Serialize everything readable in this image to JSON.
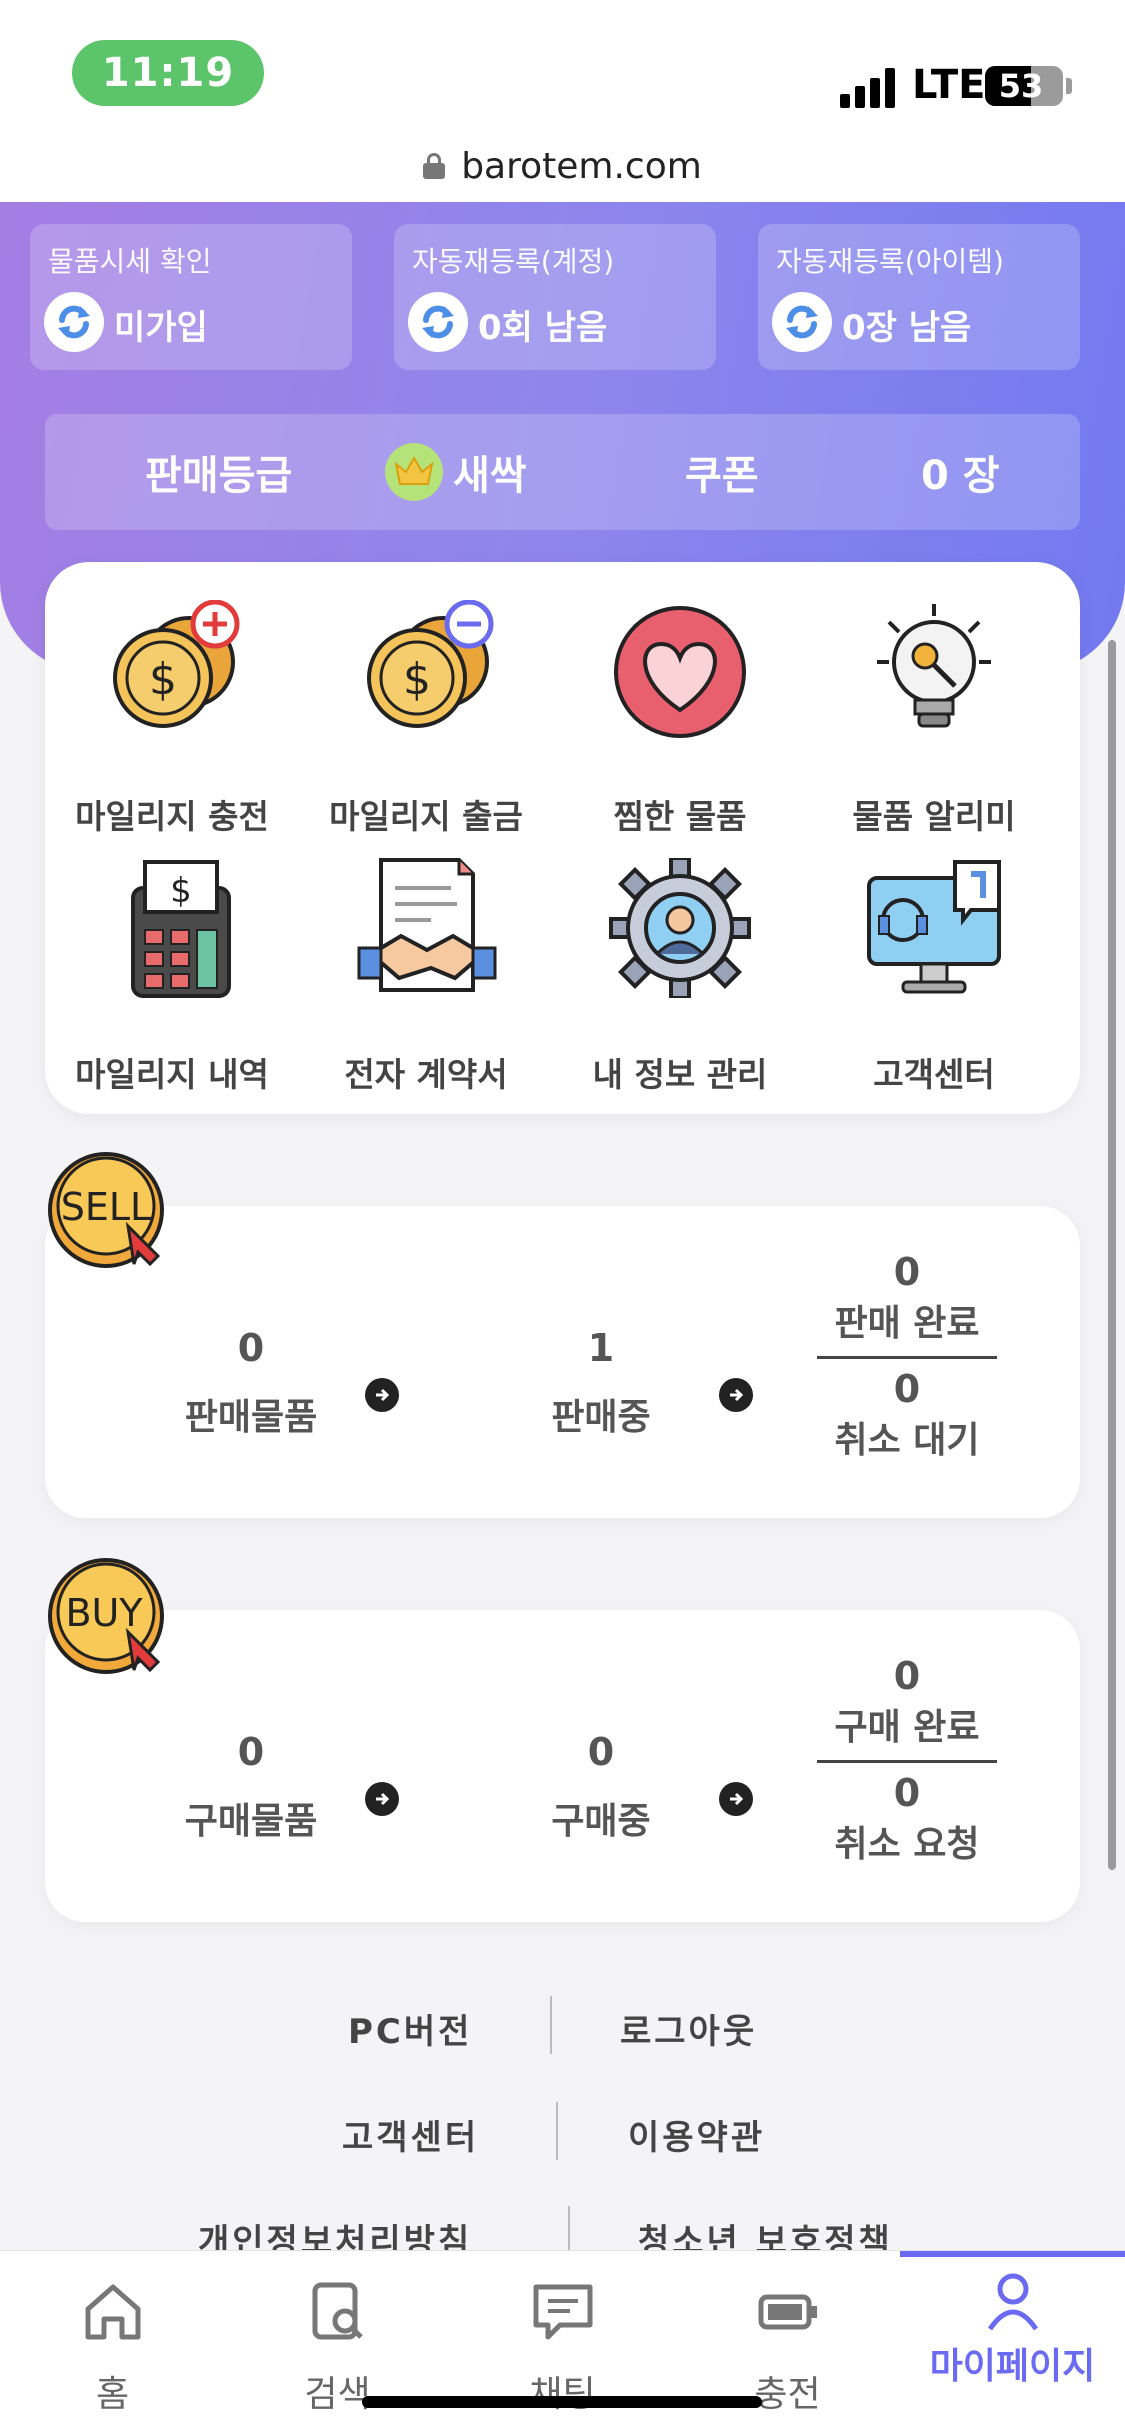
{
  "status_bar": {
    "time": "11:19",
    "network": "LTE",
    "battery": "53"
  },
  "browser": {
    "url": "barotem.com"
  },
  "header_stats": [
    {
      "label": "물품시세 확인",
      "value": "미가입"
    },
    {
      "label": "자동재등록(계정)",
      "value": "0회 남음"
    },
    {
      "label": "자동재등록(아이템)",
      "value": "0장 남음"
    }
  ],
  "grade": {
    "label": "판매등급",
    "value": "새싹",
    "coupon_label": "쿠폰",
    "coupon_value": "0 장"
  },
  "menu": [
    {
      "label": "마일리지 충전",
      "icon": "mileage-charge-icon"
    },
    {
      "label": "마일리지 출금",
      "icon": "mileage-withdraw-icon"
    },
    {
      "label": "찜한 물품",
      "icon": "heart-icon"
    },
    {
      "label": "물품 알리미",
      "icon": "lightbulb-icon"
    },
    {
      "label": "마일리지 내역",
      "icon": "calculator-icon"
    },
    {
      "label": "전자 계약서",
      "icon": "contract-handshake-icon"
    },
    {
      "label": "내 정보 관리",
      "icon": "profile-gear-icon"
    },
    {
      "label": "고객센터",
      "icon": "support-monitor-icon"
    }
  ],
  "sell": {
    "badge": "SELL",
    "items_count": "0",
    "items_label": "판매물품",
    "selling_count": "1",
    "selling_label": "판매중",
    "done_count": "0",
    "done_label": "판매 완료",
    "cancel_count": "0",
    "cancel_label": "취소 대기"
  },
  "buy": {
    "badge": "BUY",
    "items_count": "0",
    "items_label": "구매물품",
    "buying_count": "0",
    "buying_label": "구매중",
    "done_count": "0",
    "done_label": "구매 완료",
    "cancel_count": "0",
    "cancel_label": "취소 요청"
  },
  "footer": {
    "pc_version": "PC버전",
    "logout": "로그아웃",
    "support": "고객센터",
    "terms": "이용약관",
    "privacy": "개인정보처리방침",
    "youth": "청소년 보호정책"
  },
  "tabs": [
    {
      "label": "홈",
      "icon": "home-icon"
    },
    {
      "label": "검색",
      "icon": "search-doc-icon"
    },
    {
      "label": "채팅",
      "icon": "chat-icon"
    },
    {
      "label": "충전",
      "icon": "battery-icon"
    },
    {
      "label": "마이페이지",
      "icon": "person-icon",
      "active": true
    }
  ],
  "colors": {
    "accent": "#6a6af2",
    "gradient_start": "#a57ee3",
    "gradient_end": "#7279f0",
    "status_green": "#5cc46a"
  }
}
